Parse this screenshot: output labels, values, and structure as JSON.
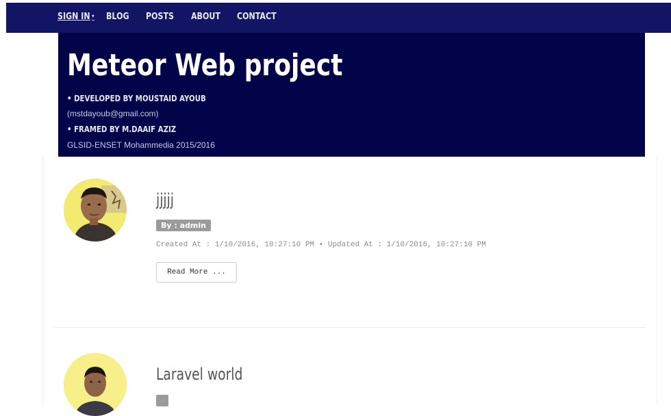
{
  "nav": {
    "signin": "SIGN IN",
    "signin_caret": "▾",
    "blog": "BLOG",
    "posts": "POSTS",
    "about": "ABOUT",
    "contact": "CONTACT"
  },
  "header": {
    "title": "Meteor Web project",
    "credit_1": "• DEVELOPED BY MOUSTAID AYOUB",
    "email": "(mstdayoub@gmail.com)",
    "credit_2": "• FRAMED BY M.DAAIF AZIZ",
    "institution": "GLSID-ENSET Mohammedia 2015/2016"
  },
  "posts": [
    {
      "title": "jjjjj",
      "author_badge": "By : admin",
      "meta": "Created At : 1/10/2016, 10:27:10 PM • Updated At : 1/10/2016, 10:27:10 PM",
      "read_more": "Read More ..."
    },
    {
      "title": "Laravel world"
    }
  ],
  "colors": {
    "nav_bg": "#111563",
    "header_bg": "#03034a",
    "badge_bg": "#9b9b9b",
    "avatar_bg": "#f4ec6e"
  },
  "icons": {
    "caret": "caret-down-icon"
  }
}
